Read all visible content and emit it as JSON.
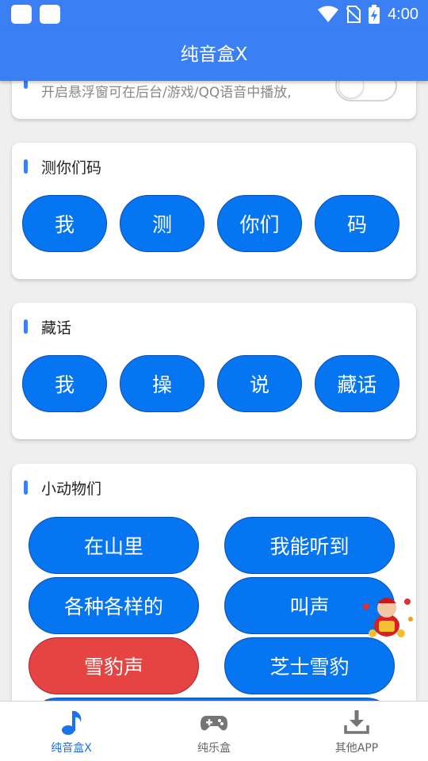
{
  "status_bar": {
    "time": "4:00"
  },
  "app_bar": {
    "title": "纯音盒X"
  },
  "float_card": {
    "desc": "开启悬浮窗可在后台/游戏/QQ语音中播放,",
    "toggle_on": false
  },
  "sections": [
    {
      "title": "测你们码",
      "buttons": [
        "我",
        "测",
        "你们",
        "码"
      ]
    },
    {
      "title": "藏话",
      "buttons": [
        "我",
        "操",
        "说",
        "藏话"
      ]
    },
    {
      "title": "小动物们",
      "buttons": [
        "在山里",
        "我能听到",
        "各种各样的",
        "叫声",
        "雪豹声",
        "芝士雪豹"
      ]
    }
  ],
  "colors": {
    "primary": "#3b7ff5",
    "button": "#0575f2",
    "highlight": "#e64343"
  },
  "bottom_nav": [
    {
      "label": "纯音盒X",
      "icon": "music-note-icon",
      "active": true
    },
    {
      "label": "纯乐盒",
      "icon": "gamepad-icon",
      "active": false
    },
    {
      "label": "其他APP",
      "icon": "download-icon",
      "active": false
    }
  ]
}
